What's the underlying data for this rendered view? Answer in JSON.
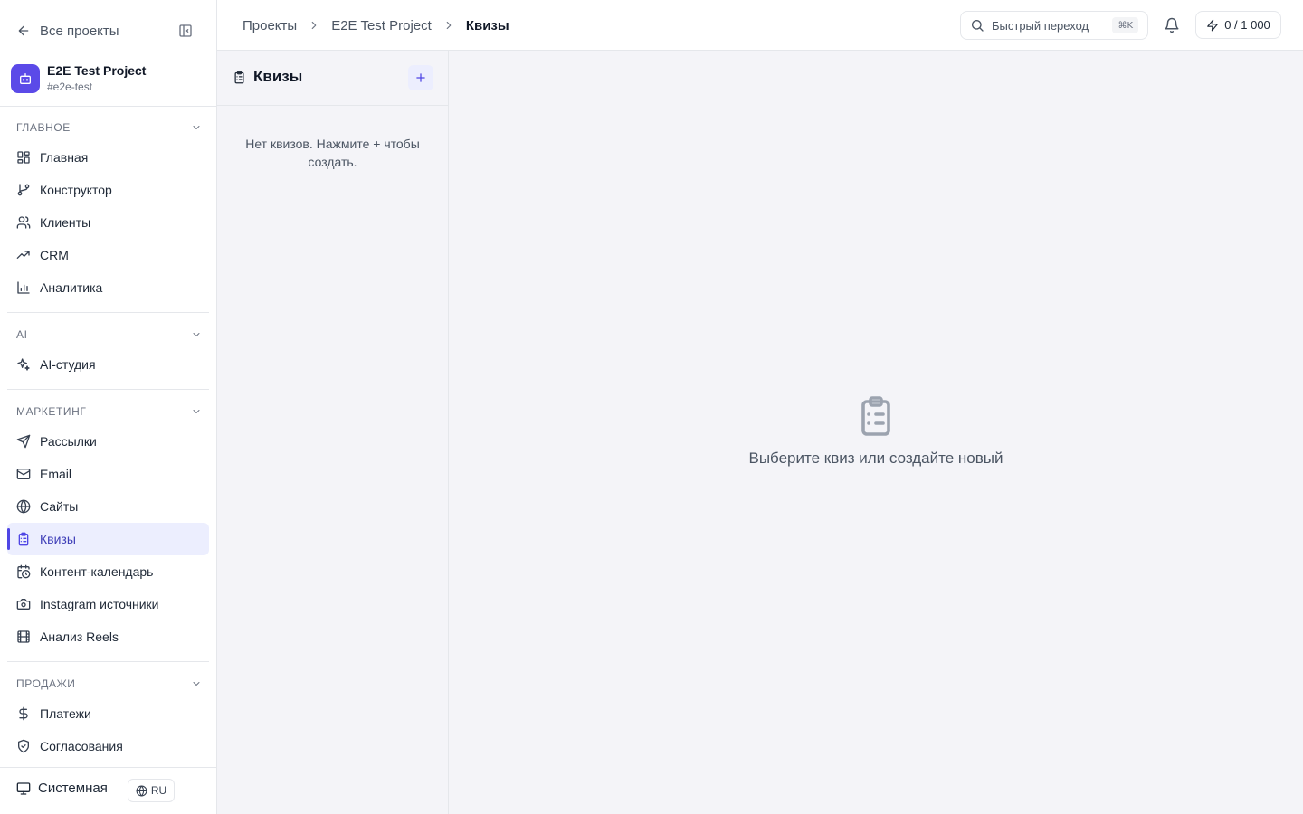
{
  "sidebar": {
    "back_label": "Все проекты",
    "project": {
      "name": "E2E Test Project",
      "slug": "#e2e-test"
    },
    "sections": [
      {
        "title": "Главное",
        "items": [
          "Главная",
          "Конструктор",
          "Клиенты",
          "CRM",
          "Аналитика"
        ]
      },
      {
        "title": "AI",
        "items": [
          "AI-студия"
        ]
      },
      {
        "title": "Маркетинг",
        "items": [
          "Рассылки",
          "Email",
          "Сайты",
          "Квизы",
          "Контент-календарь",
          "Instagram источники",
          "Анализ Reels"
        ]
      },
      {
        "title": "Продажи",
        "items": [
          "Платежи",
          "Согласования"
        ]
      }
    ],
    "active_item": "Квизы",
    "theme_label": "Системная",
    "language": "RU"
  },
  "topbar": {
    "breadcrumb": [
      "Проекты",
      "E2E Test Project",
      "Квизы"
    ],
    "search_label": "Быстрый переход",
    "search_shortcut": "⌘K",
    "credits": "0 / 1 000"
  },
  "quiz_list": {
    "title": "Квизы",
    "empty_message": "Нет квизов. Нажмите + чтобы создать."
  },
  "main": {
    "placeholder": "Выберите квиз или создайте новый"
  },
  "colors": {
    "accent": "#4f46e5",
    "active_bg": "#eceefe",
    "project_avatar": "#5b4ae8"
  }
}
